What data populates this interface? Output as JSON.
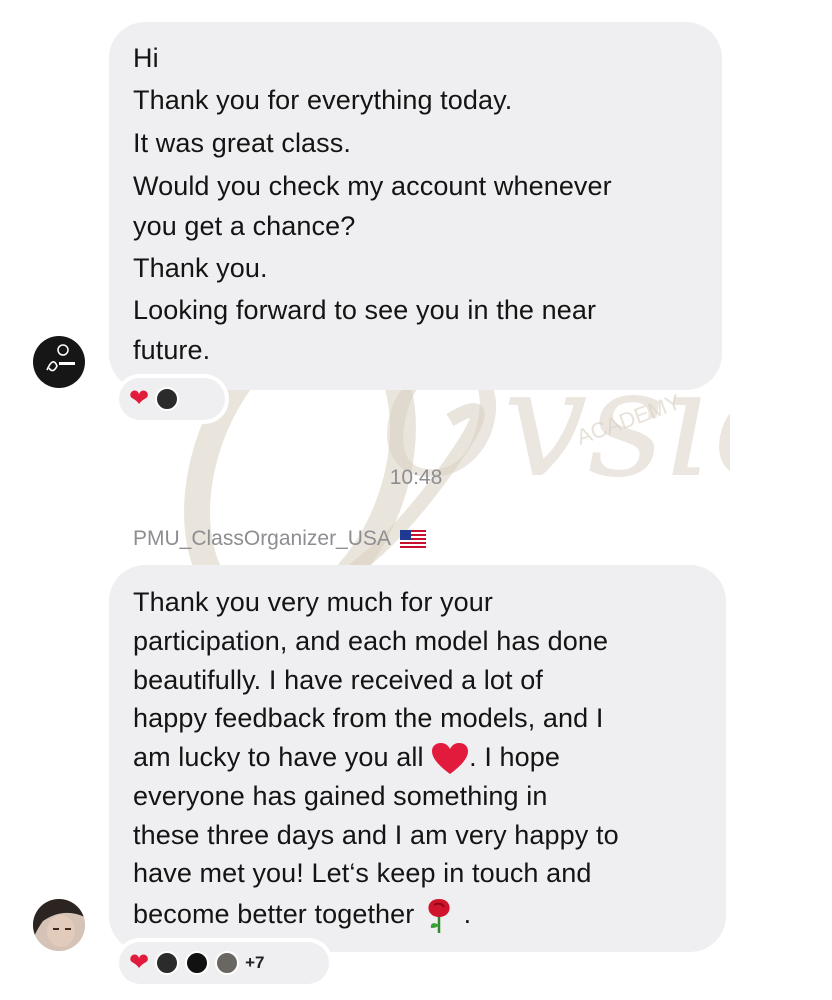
{
  "message1": {
    "lines": [
      "Hi",
      "Thank you for everything today.",
      "It was great class.",
      "Would you check my account whenever",
      "you get a chance?",
      "Thank you.",
      "Looking forward to see you in the near",
      "future."
    ],
    "reactions": {
      "heart": "❤️"
    }
  },
  "timestamp": "10:48",
  "sender_name": "PMU_ClassOrganizer_USA",
  "message2": {
    "lines": [
      "Thank you very much for your",
      "participation, and each model has done",
      "beautifully. I have received a lot of",
      "happy feedback from the models, and I",
      "am lucky to have you all",
      ". I hope",
      "everyone has gained something in",
      "these three days and I am very happy to",
      "have met you! Let‘s keep in touch and",
      "become better together",
      "."
    ],
    "reactions": {
      "heart": "❤️",
      "more_count": "+7"
    }
  },
  "watermark": {
    "brand": "Ovsion",
    "tag": "ACADEMY"
  },
  "colors": {
    "bubble": "#efeff1",
    "heart": "#e21b3c",
    "meta_text": "#8e8e92"
  }
}
